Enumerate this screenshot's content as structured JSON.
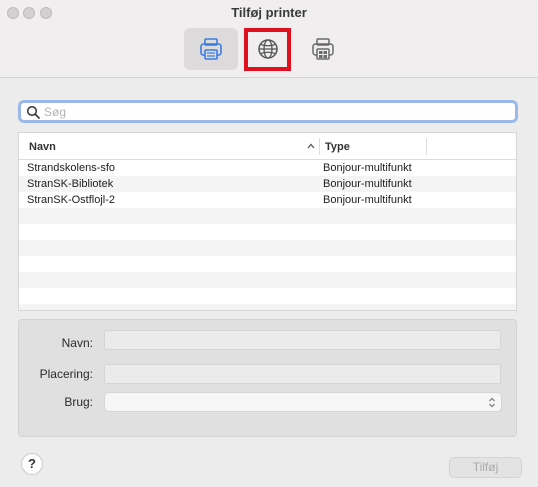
{
  "window": {
    "title": "Tilføj printer"
  },
  "toolbar": {
    "items": [
      {
        "icon": "default-printer-icon",
        "selected": true
      },
      {
        "icon": "ip-globe-icon",
        "selected": false,
        "highlighted": true
      },
      {
        "icon": "windows-printer-icon",
        "selected": false
      }
    ]
  },
  "search": {
    "placeholder": "Søg",
    "value": ""
  },
  "table": {
    "columns": [
      "Navn",
      "Type"
    ],
    "sort_column": "Navn",
    "sort_direction": "ascending",
    "rows": [
      {
        "name": "Strandskolens-sfo",
        "type": "Bonjour-multifunkt"
      },
      {
        "name": "StranSK-Bibliotek",
        "type": "Bonjour-multifunkt"
      },
      {
        "name": "StranSK-Ostflojl-2",
        "type": "Bonjour-multifunkt"
      }
    ]
  },
  "form": {
    "name_label": "Navn:",
    "location_label": "Placering:",
    "use_label": "Brug:",
    "name_value": "",
    "location_value": "",
    "use_value": ""
  },
  "footer": {
    "help_label": "?",
    "add_label": "Tilføj",
    "add_enabled": false
  },
  "colors": {
    "highlight": "#e0101f",
    "focus_ring": "#9bb8e8",
    "selected_icon": "#3b7be0"
  }
}
